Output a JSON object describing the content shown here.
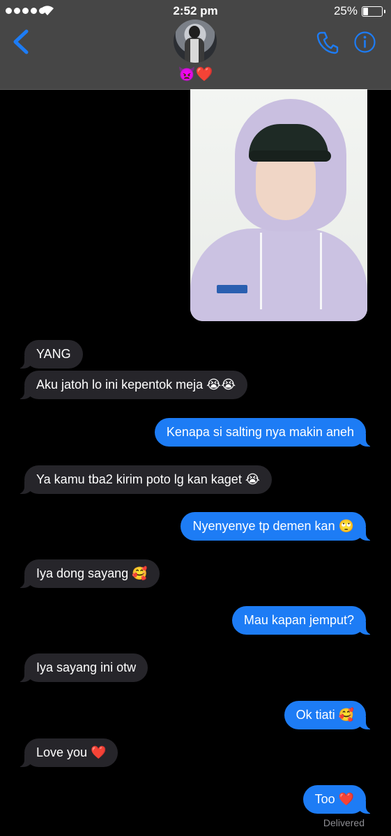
{
  "status_bar": {
    "time": "2:52 pm",
    "battery_percent": "25%",
    "battery_level": 0.25
  },
  "header": {
    "contact_name": "👿❤️"
  },
  "messages": [
    {
      "from": "contact",
      "text": "YANG"
    },
    {
      "from": "contact",
      "text": "Aku jatoh lo ini kepentok meja 😭😭"
    },
    {
      "from": "me",
      "text": "Kenapa si salting nya makin aneh"
    },
    {
      "from": "contact",
      "text": "Ya kamu tba2 kirim poto lg kan kaget 😭"
    },
    {
      "from": "me",
      "text": "Nyenyenye tp demen kan 🙄"
    },
    {
      "from": "contact",
      "text": "Iya dong sayang 🥰"
    },
    {
      "from": "me",
      "text": "Mau kapan jemput?"
    },
    {
      "from": "contact",
      "text": "Iya sayang ini otw"
    },
    {
      "from": "me",
      "text": "Ok tiati 🥰"
    },
    {
      "from": "contact",
      "text": "Love you ❤️"
    },
    {
      "from": "me",
      "text": "Too ❤️"
    }
  ],
  "delivered_label": "Delivered",
  "colors": {
    "accent": "#1d7cf5",
    "incoming_bubble": "#26252a",
    "navbar": "#464646"
  },
  "icons": [
    "back-chevron-icon",
    "phone-icon",
    "info-icon",
    "wifi-icon",
    "battery-icon"
  ]
}
